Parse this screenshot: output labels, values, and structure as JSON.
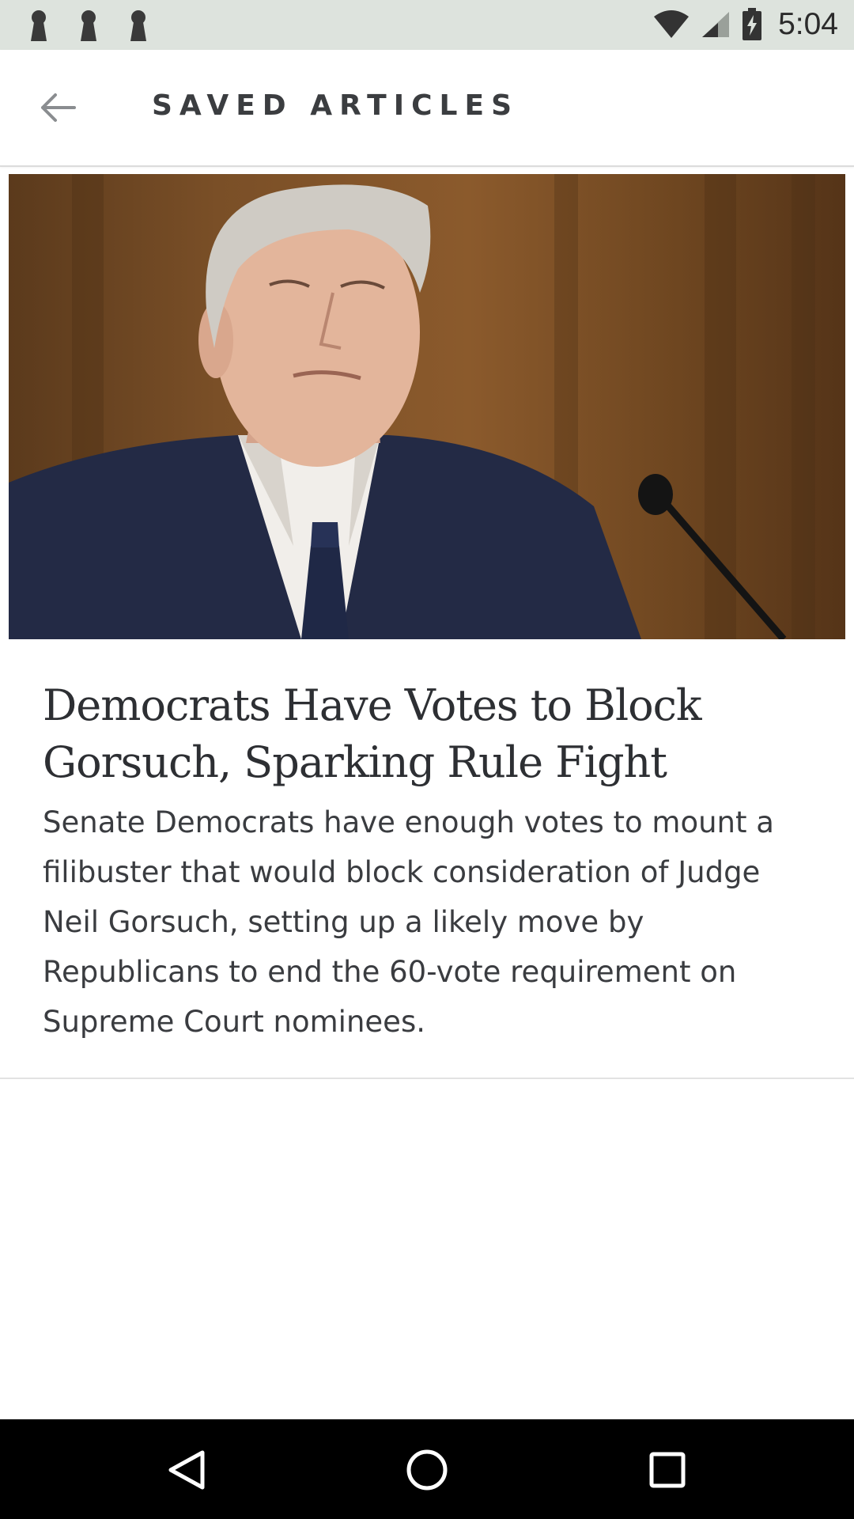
{
  "status_bar": {
    "time": "5:04",
    "icons": [
      "notification-keyhole-icon",
      "notification-keyhole-icon",
      "notification-keyhole-icon",
      "wifi-icon",
      "cell-signal-icon",
      "battery-charging-icon"
    ]
  },
  "app_bar": {
    "back_icon": "arrow-left-icon",
    "title": "SAVED ARTICLES"
  },
  "articles": [
    {
      "headline": "Democrats Have Votes to Block Gorsuch, Sparking Rule Fight",
      "summary": "Senate Democrats have enough votes to mount a filibuster that would block consideration of Judge Neil Gorsuch, setting up a likely move by Republicans to end the 60-vote requirement on Supreme Court nominees."
    }
  ],
  "nav_bar": {
    "icons": [
      "back-triangle-icon",
      "home-circle-icon",
      "recents-square-icon"
    ]
  },
  "colors": {
    "status_bar": "#dde3dd",
    "text_primary": "#2d2f33",
    "nav_bar": "#000000"
  }
}
